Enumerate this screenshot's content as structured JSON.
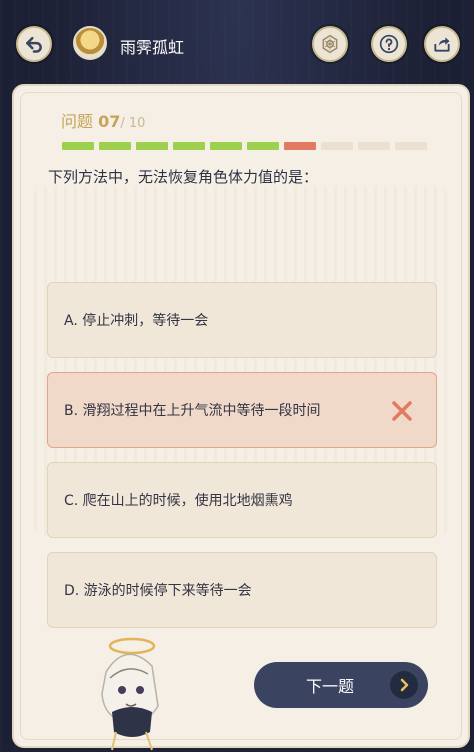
{
  "header": {
    "username": "雨霁孤虹",
    "icons": [
      "back-icon",
      "compass-icon",
      "help-icon",
      "share-icon"
    ]
  },
  "quiz": {
    "label": "问题",
    "current": "07",
    "total": "/ 10",
    "progress": [
      "correct",
      "correct",
      "correct",
      "correct",
      "correct",
      "correct",
      "wrong",
      "pending",
      "pending",
      "pending"
    ],
    "question": "下列方法中，无法恢复角色体力值的是："
  },
  "options": [
    {
      "text": "A. 停止冲刺，等待一会",
      "state": "normal"
    },
    {
      "text": "B. 滑翔过程中在上升气流中等待一段时间",
      "state": "wrong"
    },
    {
      "text": "C. 爬在山上的时候，使用北地烟熏鸡",
      "state": "normal"
    },
    {
      "text": "D. 游泳的时候停下来等待一会",
      "state": "normal"
    }
  ],
  "next_button": {
    "label": "下一题"
  },
  "colors": {
    "correct": "#9ed04f",
    "wrong": "#e27a60",
    "pending": "#ece1d1",
    "accent": "#c6a45b"
  }
}
